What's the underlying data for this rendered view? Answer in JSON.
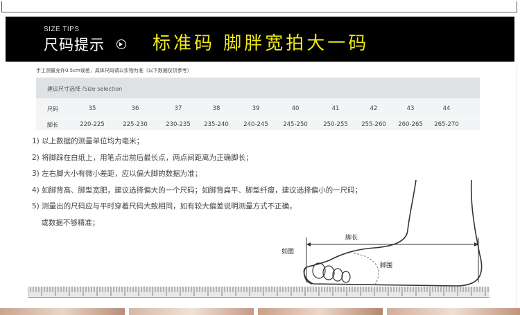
{
  "banner": {
    "size_tips_en": "SIZE TIPS",
    "size_tips_cn": "尺码提示",
    "headline": "标准码  脚胖宽拍大一码",
    "headline_color": "#f0e817"
  },
  "note": "手工测量允许0.5cm误差，具体尺码请以实物为准（以下数据仅供参考）",
  "table": {
    "title": "建议尺寸选择  /Size selection",
    "size_label": "尺码",
    "length_label": "脚长",
    "sizes": [
      "35",
      "36",
      "37",
      "38",
      "39",
      "40",
      "41",
      "42",
      "43",
      "44"
    ],
    "lengths": [
      "220-225",
      "225-230",
      "230-235",
      "235-240",
      "240-245",
      "245-250",
      "250-255",
      "255-260",
      "260-265",
      "265-270"
    ]
  },
  "tips": [
    "1) 以上数据的测量单位均为毫米；",
    "2) 将脚踩在白纸上，用笔点出前后最长点，两点间距离为正确脚长；",
    "3) 左右脚大小有微小差距，应以偏大脚的数据为准；",
    "4) 如脚背高、脚型宽肥，建议选择偏大的一个尺码；如脚背扁平、脚型纤瘦，建议选择偏小的一尺码；",
    "5) 测量出的尺码应与平时穿着尺码大致相同，如有较大偏差说明测量方式不正确，",
    "    或数据不够精准；"
  ],
  "diagram": {
    "figure_label": "如图",
    "length_label": "脚长",
    "girth_label": "脚围"
  },
  "icons": [
    "play-circle-icon"
  ]
}
